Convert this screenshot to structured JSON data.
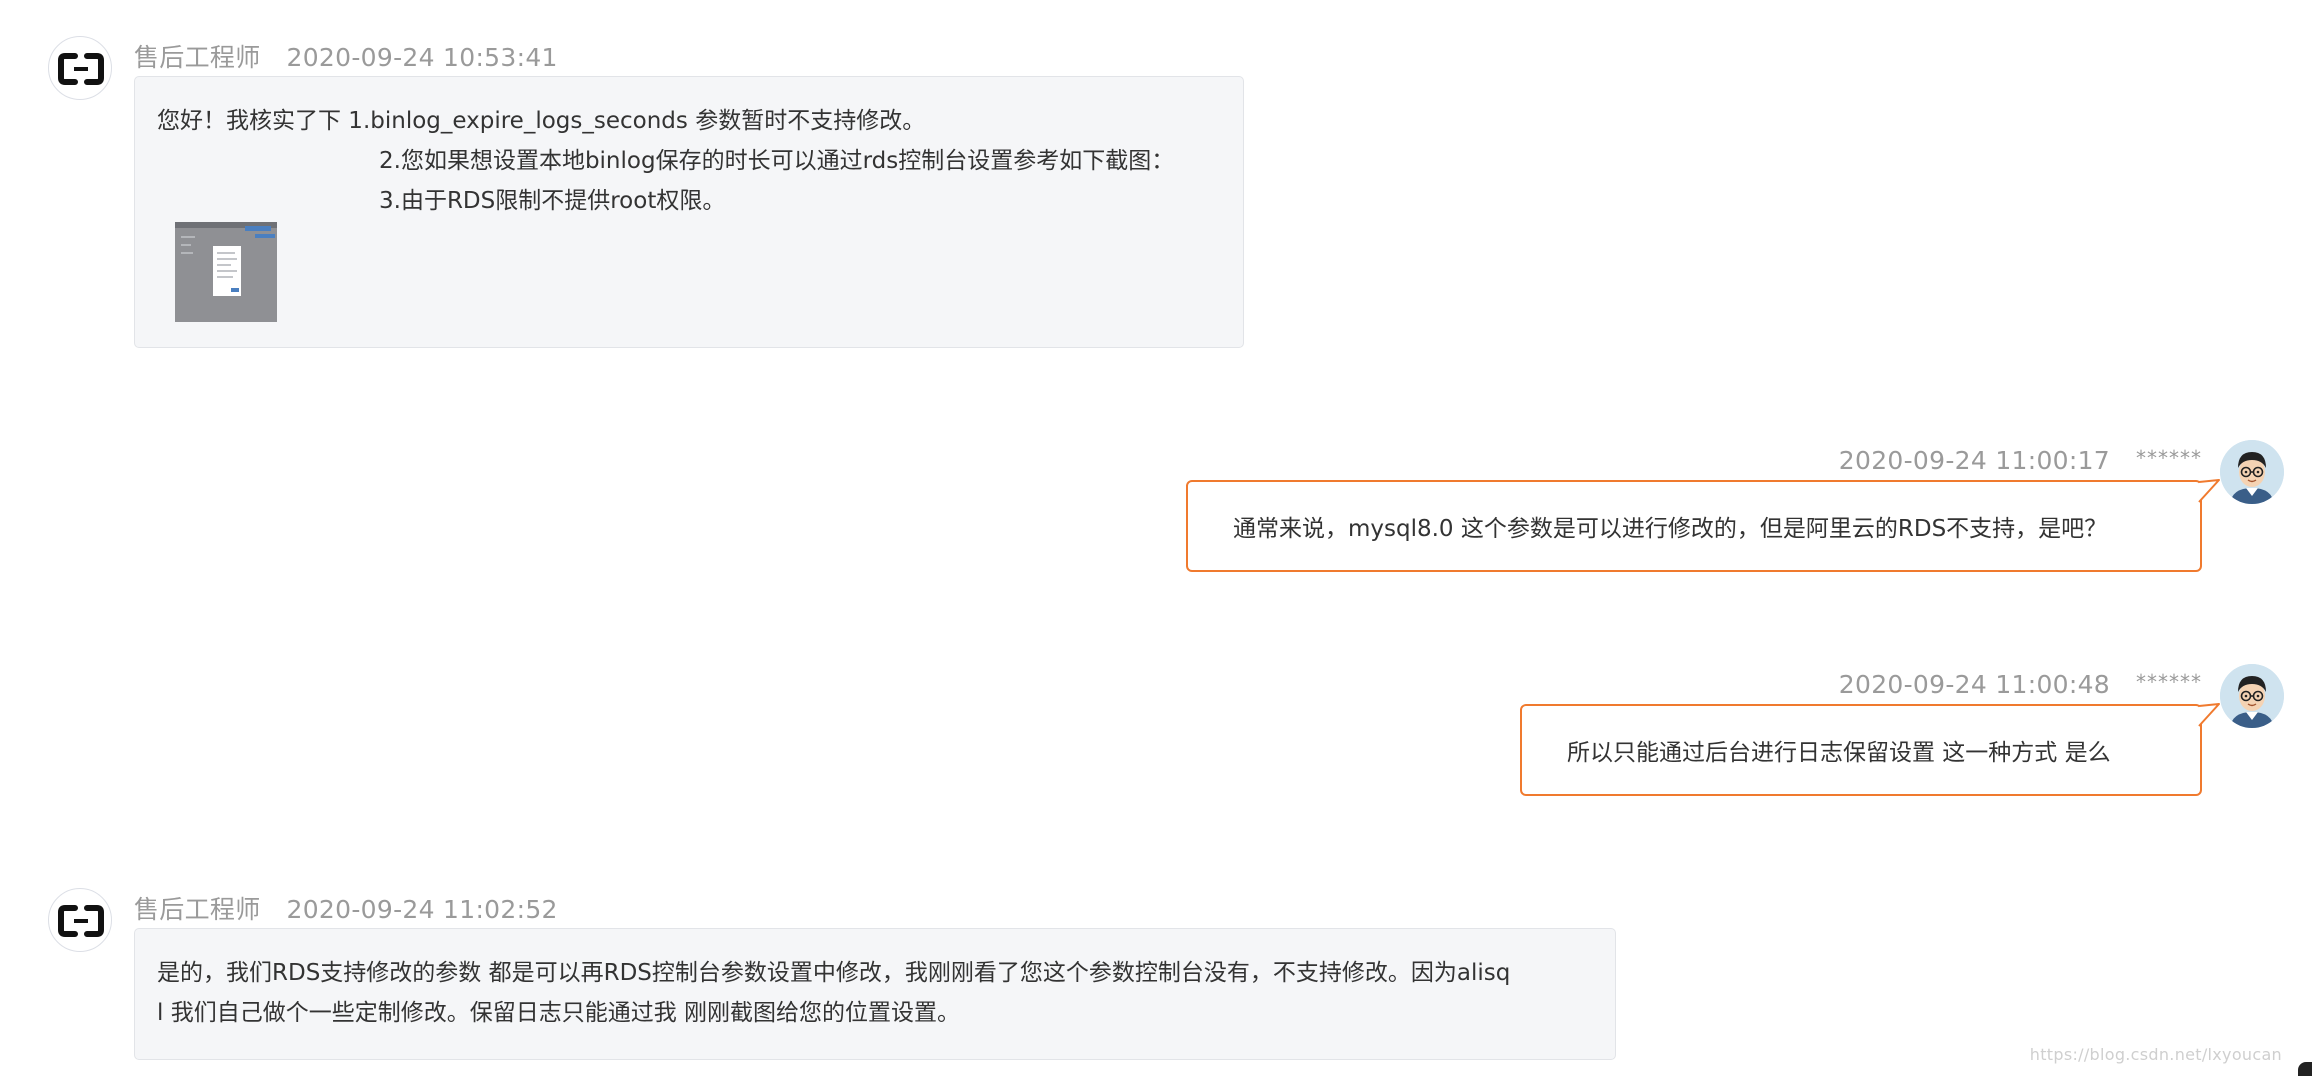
{
  "messages": [
    {
      "sender": "agent",
      "name": "售后工程师",
      "time": "2020-09-24 10:53:41",
      "lines": [
        "您好！我核实了下 1.binlog_expire_logs_seconds 参数暂时不支持修改。",
        "2.您如果想设置本地binlog保存的时长可以通过rds控制台设置参考如下截图：",
        "3.由于RDS限制不提供root权限。"
      ],
      "has_image": true
    },
    {
      "sender": "user",
      "time": "2020-09-24 11:00:17",
      "user_mask": "******",
      "text": "通常来说，mysql8.0 这个参数是可以进行修改的，但是阿里云的RDS不支持，是吧？"
    },
    {
      "sender": "user",
      "time": "2020-09-24 11:00:48",
      "user_mask": "******",
      "text": "所以只能通过后台进行日志保留设置 这一种方式   是么"
    },
    {
      "sender": "agent",
      "name": "售后工程师",
      "time": "2020-09-24 11:02:52",
      "lines": [
        "是的，我们RDS支持修改的参数 都是可以再RDS控制台参数设置中修改，我刚刚看了您这个参数控制台没有，不支持修改。因为alisq",
        "l 我们自己做个一些定制修改。保留日志只能通过我 刚刚截图给您的位置设置。"
      ],
      "has_image": false
    }
  ],
  "watermark": "https://blog.csdn.net/lxyoucan",
  "colors": {
    "user_bubble_border": "#f07a2e",
    "agent_bubble_bg": "#f5f6f8",
    "meta_text": "#9a9a9a"
  }
}
